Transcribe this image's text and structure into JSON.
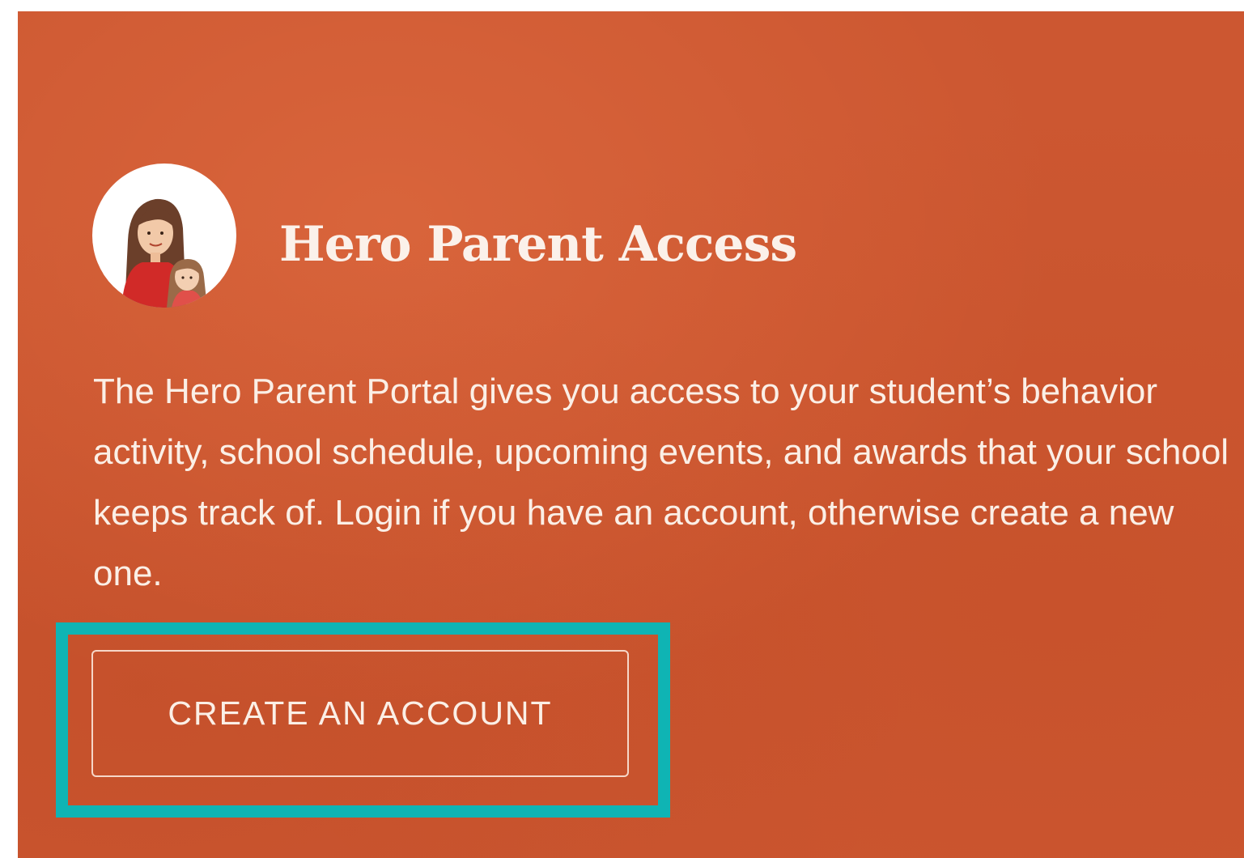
{
  "card": {
    "title": "Hero Parent Access",
    "description": "The Hero Parent Portal gives you access to your student’s behavior activity, school schedule, upcoming events, and awards that your school keeps track of. Login if you have an account, otherwise create a new one.",
    "create_account_label": "CREATE AN ACCOUNT",
    "avatar_icon": "parent-and-child-icon"
  },
  "colors": {
    "panel_background": "#cc5731",
    "text": "#fbefe6",
    "highlight": "#0fb4b4",
    "button_border": "#f6d7c8"
  }
}
